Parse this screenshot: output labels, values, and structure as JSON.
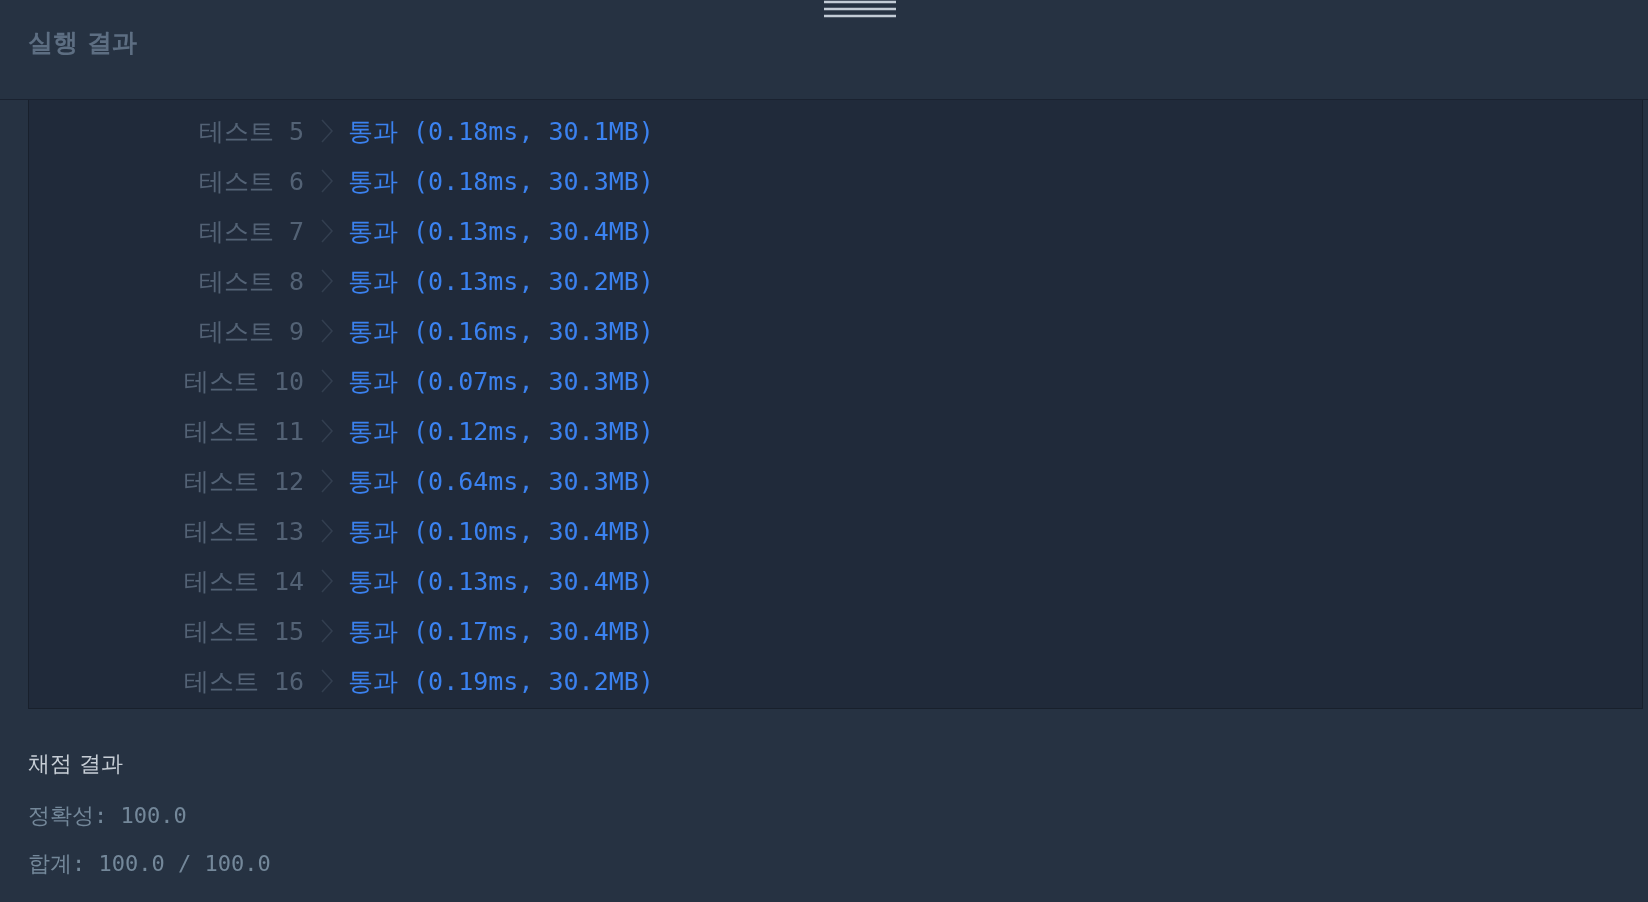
{
  "panel": {
    "title": "실행 결과"
  },
  "tests": [
    {
      "label": "테스트 5",
      "result": "통과 (0.18ms, 30.1MB)"
    },
    {
      "label": "테스트 6",
      "result": "통과 (0.18ms, 30.3MB)"
    },
    {
      "label": "테스트 7",
      "result": "통과 (0.13ms, 30.4MB)"
    },
    {
      "label": "테스트 8",
      "result": "통과 (0.13ms, 30.2MB)"
    },
    {
      "label": "테스트 9",
      "result": "통과 (0.16ms, 30.3MB)"
    },
    {
      "label": "테스트 10",
      "result": "통과 (0.07ms, 30.3MB)"
    },
    {
      "label": "테스트 11",
      "result": "통과 (0.12ms, 30.3MB)"
    },
    {
      "label": "테스트 12",
      "result": "통과 (0.64ms, 30.3MB)"
    },
    {
      "label": "테스트 13",
      "result": "통과 (0.10ms, 30.4MB)"
    },
    {
      "label": "테스트 14",
      "result": "통과 (0.13ms, 30.4MB)"
    },
    {
      "label": "테스트 15",
      "result": "통과 (0.17ms, 30.4MB)"
    },
    {
      "label": "테스트 16",
      "result": "통과 (0.19ms, 30.2MB)"
    }
  ],
  "grading": {
    "title": "채점 결과",
    "accuracy": "정확성: 100.0",
    "total": "합계: 100.0 / 100.0"
  }
}
